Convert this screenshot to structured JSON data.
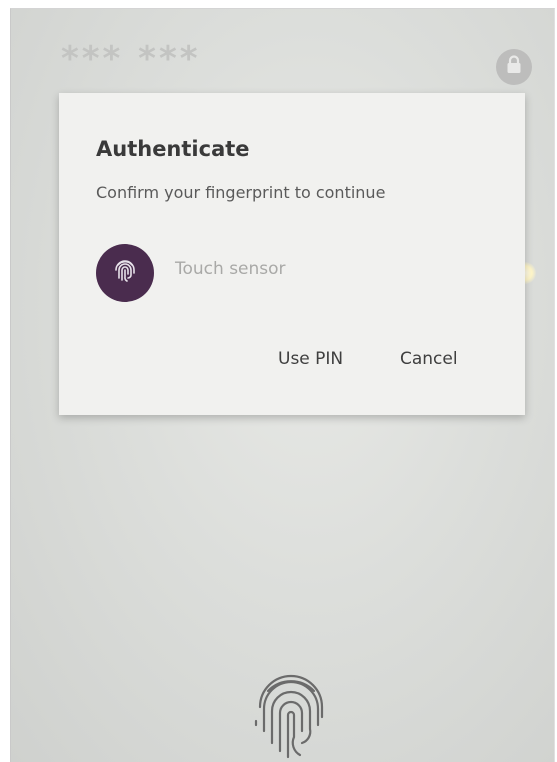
{
  "header": {
    "masked_text": "*** ***",
    "lock_icon": "lock-icon"
  },
  "dialog": {
    "title": "Authenticate",
    "subtitle": "Confirm your fingerprint to continue",
    "sensor_icon": "fingerprint-icon",
    "sensor_label": "Touch sensor",
    "use_pin_label": "Use PIN",
    "cancel_label": "Cancel"
  },
  "bottom": {
    "fingerprint_icon": "fingerprint-icon"
  },
  "colors": {
    "accent": "#4a2c4e",
    "dialog_bg": "#f1f1ef",
    "screen_bg": "#dcdedb"
  }
}
